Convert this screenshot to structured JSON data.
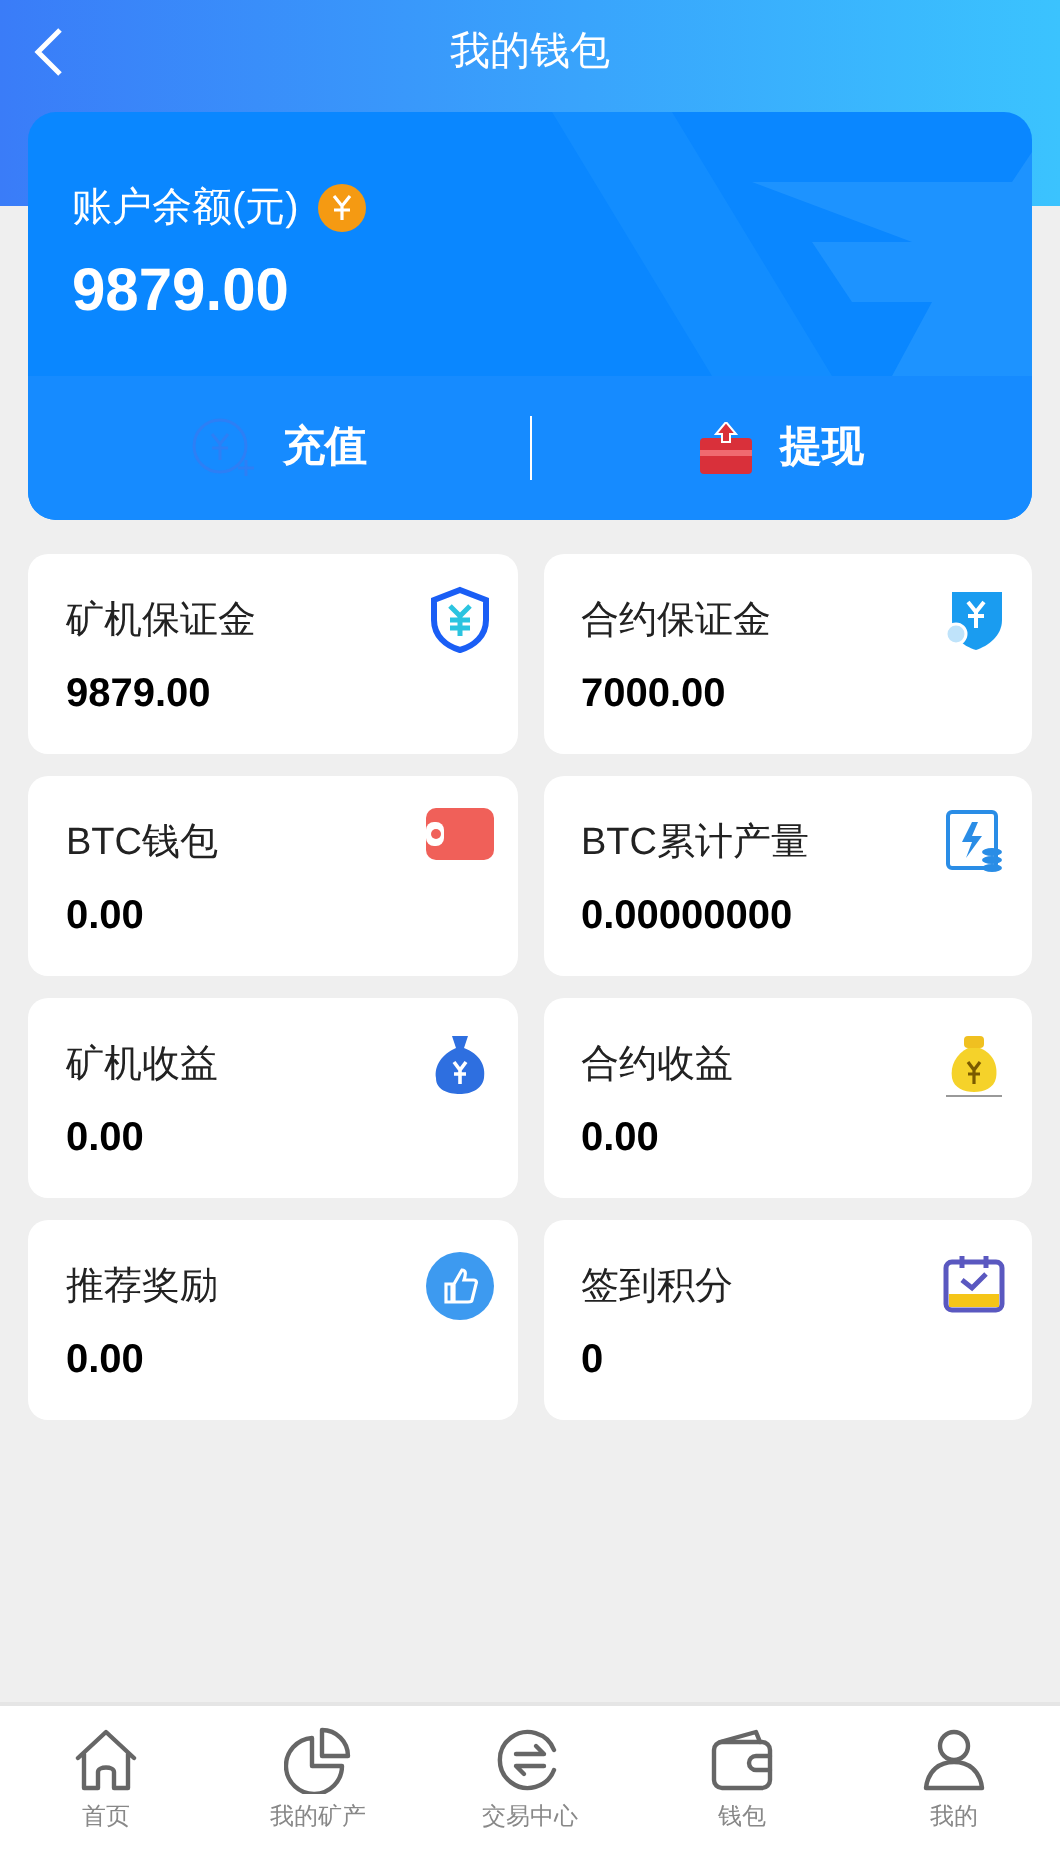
{
  "header": {
    "title": "我的钱包"
  },
  "balance": {
    "label": "账户余额(元)",
    "amount": "9879.00"
  },
  "actions": [
    {
      "kind": "recharge",
      "label": "充值"
    },
    {
      "kind": "withdraw",
      "label": "提现"
    }
  ],
  "stats": [
    {
      "label": "矿机保证金",
      "value": "9879.00",
      "kind": "shield"
    },
    {
      "label": "合约保证金",
      "value": "7000.00",
      "kind": "shield-badge"
    },
    {
      "label": "BTC钱包",
      "value": "0.00",
      "kind": "wallet"
    },
    {
      "label": "BTC累计产量",
      "value": "0.00000000",
      "kind": "output"
    },
    {
      "label": "矿机收益",
      "value": "0.00",
      "kind": "bag-blue"
    },
    {
      "label": "合约收益",
      "value": "0.00",
      "kind": "bag-gold"
    },
    {
      "label": "推荐奖励",
      "value": "0.00",
      "kind": "thumb"
    },
    {
      "label": "签到积分",
      "value": "0",
      "kind": "calendar"
    }
  ],
  "tab_bar": [
    {
      "label": "首页",
      "kind": "home"
    },
    {
      "label": "我的矿产",
      "kind": "pie"
    },
    {
      "label": "交易中心",
      "kind": "exchange"
    },
    {
      "label": "钱包",
      "kind": "wallet"
    },
    {
      "label": "我的",
      "kind": "user"
    }
  ]
}
